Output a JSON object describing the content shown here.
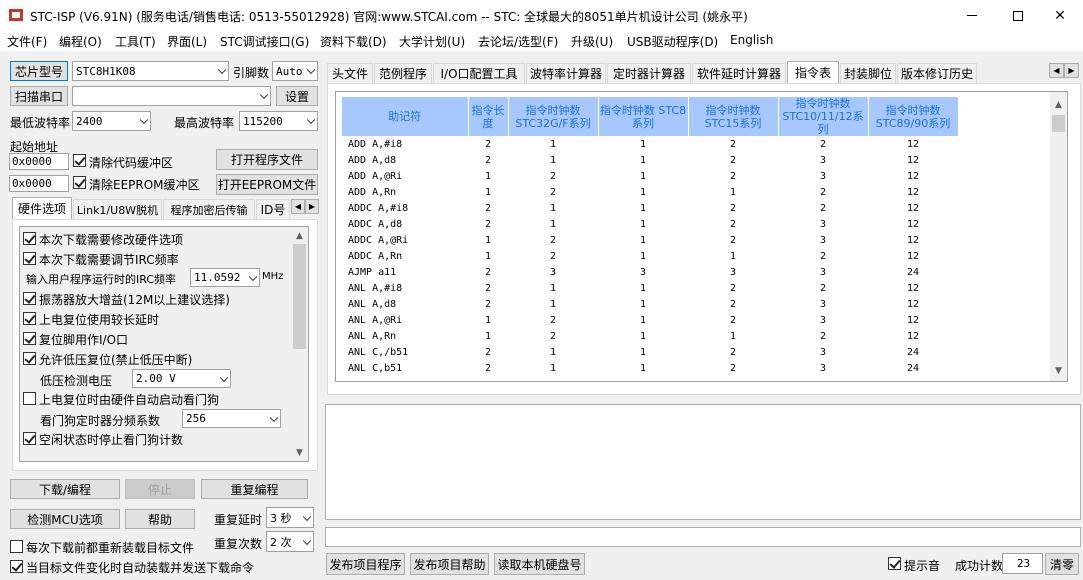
{
  "window": {
    "title": "STC-ISP (V6.91N) (服务电话/销售电话: 0513-55012928) 官网:www.STCAI.com  -- STC: 全球最大的8051单片机设计公司 (姚永平)"
  },
  "menu": [
    "文件(F)",
    "编程(O)",
    "工具(T)",
    "界面(L)",
    "STC调试接口(G)",
    "资料下载(D)",
    "大学计划(U)",
    "去论坛/选型(F)",
    "升级(U)",
    "USB驱动程序(D)",
    "English"
  ],
  "left": {
    "chip_btn": "芯片型号",
    "chip_value": "STC8H1K08",
    "pin_label": "引脚数",
    "pin_value": "Auto",
    "scan_btn": "扫描串口",
    "port_value": "",
    "settings_btn": "设置",
    "min_baud_label": "最低波特率",
    "min_baud": "2400",
    "max_baud_label": "最高波特率",
    "max_baud": "115200",
    "start_addr_label": "起始地址",
    "addr1": "0x0000",
    "clear_code": "清除代码缓冲区",
    "open_prog": "打开程序文件",
    "addr2": "0x0000",
    "clear_eeprom": "清除EEPROM缓冲区",
    "open_eeprom": "打开EEPROM文件",
    "tabs": [
      "硬件选项",
      "Link1/U8W脱机",
      "程序加密后传输",
      "ID号"
    ],
    "options": {
      "o1": "本次下载需要修改硬件选项",
      "o2": "本次下载需要调节IRC频率",
      "irc_label": "输入用户程序运行时的IRC频率",
      "irc_value": "11.0592",
      "irc_unit": "MHz",
      "o3": "振荡器放大增益(12M以上建议选择)",
      "o4": "上电复位使用较长延时",
      "o5": "复位脚用作I/O口",
      "o6": "允许低压复位(禁止低压中断)",
      "lv_label": "低压检测电压",
      "lv_value": "2.00 V",
      "o7": "上电复位时由硬件自动启动看门狗",
      "wdt_label": "看门狗定时器分频系数",
      "wdt_value": "256",
      "o8": "空闲状态时停止看门狗计数"
    },
    "download_btn": "下载/编程",
    "stop_btn": "停止",
    "reprog_btn": "重复编程",
    "detect_btn": "检测MCU选项",
    "help_btn": "帮助",
    "delay_label": "重复延时",
    "delay_value": "3 秒",
    "repeat_label": "重复次数",
    "repeat_value": "2 次",
    "reload_label": "每次下载前都重新装载目标文件",
    "autosend_label": "当目标文件变化时自动装载并发送下载命令"
  },
  "right": {
    "tabs": [
      "头文件",
      "范例程序",
      "I/O口配置工具",
      "波特率计算器",
      "定时器计算器",
      "软件延时计算器",
      "指令表",
      "封装脚位",
      "版本修订历史"
    ],
    "table": {
      "headers": [
        "助记符",
        "指令长度",
        "指令时钟数 STC32G/F系列",
        "指令时钟数 STC8系列",
        "指令时钟数 STC15系列",
        "指令时钟数 STC10/11/12系列",
        "指令时钟数 STC89/90系列"
      ],
      "rows": [
        [
          "ADD A,#i8",
          "2",
          "1",
          "1",
          "2",
          "2",
          "12"
        ],
        [
          "ADD A,d8",
          "2",
          "1",
          "1",
          "2",
          "3",
          "12"
        ],
        [
          "ADD A,@Ri",
          "1",
          "2",
          "1",
          "2",
          "3",
          "12"
        ],
        [
          "ADD A,Rn",
          "1",
          "2",
          "1",
          "1",
          "2",
          "12"
        ],
        [
          "ADDC A,#i8",
          "2",
          "1",
          "1",
          "2",
          "2",
          "12"
        ],
        [
          "ADDC A,d8",
          "2",
          "1",
          "1",
          "2",
          "3",
          "12"
        ],
        [
          "ADDC A,@Ri",
          "1",
          "2",
          "1",
          "2",
          "3",
          "12"
        ],
        [
          "ADDC A,Rn",
          "1",
          "2",
          "1",
          "1",
          "2",
          "12"
        ],
        [
          "AJMP a11",
          "2",
          "3",
          "3",
          "3",
          "3",
          "24"
        ],
        [
          "ANL A,#i8",
          "2",
          "1",
          "1",
          "2",
          "2",
          "12"
        ],
        [
          "ANL A,d8",
          "2",
          "1",
          "1",
          "2",
          "3",
          "12"
        ],
        [
          "ANL A,@Ri",
          "1",
          "2",
          "1",
          "2",
          "3",
          "12"
        ],
        [
          "ANL A,Rn",
          "1",
          "2",
          "1",
          "1",
          "2",
          "12"
        ],
        [
          "ANL C,/b51",
          "2",
          "1",
          "1",
          "2",
          "3",
          "24"
        ],
        [
          "ANL C,b51",
          "2",
          "1",
          "1",
          "2",
          "3",
          "24"
        ]
      ]
    },
    "publish_btn": "发布项目程序",
    "publish_help_btn": "发布项目帮助",
    "read_disk_btn": "读取本机硬盘号",
    "beep_label": "提示音",
    "success_label": "成功计数",
    "success_value": "23",
    "clear_btn": "清零"
  }
}
